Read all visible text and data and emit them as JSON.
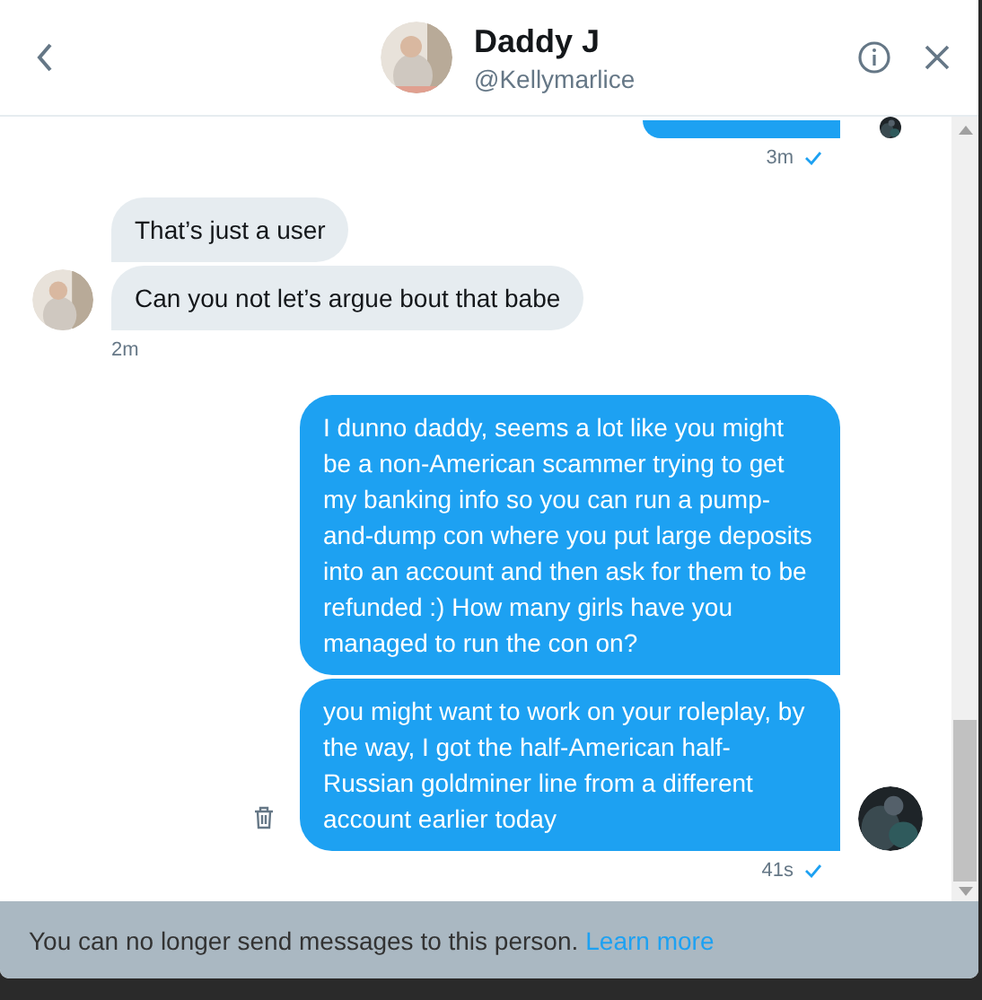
{
  "header": {
    "name": "Daddy J",
    "handle": "@Kellymarlice"
  },
  "conversation": [
    {
      "kind": "sent",
      "clipped_bubble": true,
      "time": "3m",
      "read": true
    },
    {
      "kind": "received",
      "bubbles": [
        "That’s just a user",
        "Can you not let’s argue bout that babe"
      ],
      "time": "2m"
    },
    {
      "kind": "sent",
      "bubbles": [
        "I dunno daddy, seems a lot like you might be a non-American scammer trying to get my banking info so you can run a pump-and-dump con where you put large deposits into an account and then ask for them to be refunded :) How many girls have you managed to run the con on?",
        "you might want to work on your roleplay, by the way, I got the half-American half-Russian goldminer line from a different account earlier today"
      ],
      "time": "41s",
      "read": true,
      "delete_icon": true
    }
  ],
  "notice": {
    "text": "You can no longer send messages to this person.",
    "link": "Learn more"
  }
}
